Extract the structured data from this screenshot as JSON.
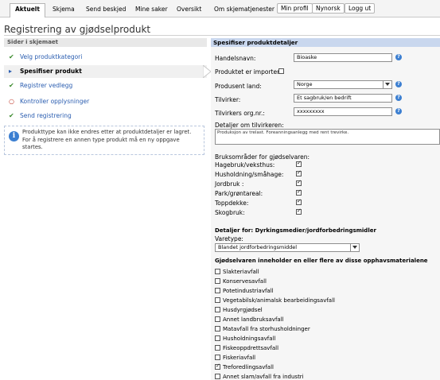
{
  "nav": {
    "tabs": [
      "Aktuelt",
      "Skjema",
      "Send beskjed",
      "Mine saker",
      "Oversikt",
      "Om skjematjenester",
      "Min profil",
      "Nynorsk",
      "Logg ut"
    ]
  },
  "page": {
    "title": "Registrering av gjødselprodukt"
  },
  "sidebar": {
    "header": "Sider i skjemaet",
    "steps": [
      {
        "label": "Velg produktkategori",
        "status": "done"
      },
      {
        "label": "Spesifiser produkt",
        "status": "current"
      },
      {
        "label": "Registrer vedlegg",
        "status": "done"
      },
      {
        "label": "Kontroller opplysninger",
        "status": "pending"
      },
      {
        "label": "Send registrering",
        "status": "done"
      }
    ],
    "info": "Produkttype kan ikke endres etter at produktdetaljer er lagret. For å registrere en annen type produkt må en ny oppgave startes."
  },
  "form": {
    "header": "Spesifiser produktdetaljer",
    "handelsnavn": {
      "label": "Handelsnavn:",
      "value": "Bioaske"
    },
    "importert": {
      "label": "Produktet er importert:",
      "checked": false
    },
    "produsent_land": {
      "label": "Produsent land:",
      "value": "Norge"
    },
    "tilvirker": {
      "label": "Tilvirker:",
      "value": "Et sagbruk/en bedrift"
    },
    "orgnr": {
      "label": "Tilvirkers org.nr.:",
      "value": "xxxxxxxxx"
    },
    "detaljer": {
      "label": "Detaljer om tilvirkeren:",
      "value": "Produksjon av trelast. Foreanningsanlegg med rent trevirke."
    },
    "bruk": {
      "label": "Bruksområder for gjødselvaren:",
      "items": [
        {
          "label": "Hagebruk/veksthus:",
          "checked": true
        },
        {
          "label": "Husholdning/småhage:",
          "checked": true
        },
        {
          "label": "Jordbruk :",
          "checked": true
        },
        {
          "label": "Park/grøntareal:",
          "checked": true
        },
        {
          "label": "Toppdekke:",
          "checked": true
        },
        {
          "label": "Skogbruk:",
          "checked": true
        }
      ]
    },
    "detaljer_for": "Detaljer for: Dyrkingsmedier/jordforbedringsmidler",
    "varetype": {
      "label": "Varetype:",
      "value": "Blandet jordforbedringsmiddel"
    },
    "opphav": {
      "label": "Gjødselvaren inneholder en eller flere av disse opphavsmaterialene",
      "items": [
        {
          "label": "Slakteriavfall",
          "checked": false
        },
        {
          "label": "Konservesavfall",
          "checked": false
        },
        {
          "label": "Potetindustriavfall",
          "checked": false
        },
        {
          "label": "Vegetabilsk/animalsk bearbeidingsavfall",
          "checked": false
        },
        {
          "label": "Husdyrgjødsel",
          "checked": false
        },
        {
          "label": "Annet landbruksavfall",
          "checked": false
        },
        {
          "label": "Matavfall fra storhusholdninger",
          "checked": false
        },
        {
          "label": "Husholdningsavfall",
          "checked": false
        },
        {
          "label": "Fiskeoppdrettsavfall",
          "checked": false
        },
        {
          "label": "Fiskeriavfall",
          "checked": false
        },
        {
          "label": "Treforedlingsavfall",
          "checked": true
        },
        {
          "label": "Annet slam/avfall fra industri",
          "checked": false
        }
      ]
    }
  }
}
